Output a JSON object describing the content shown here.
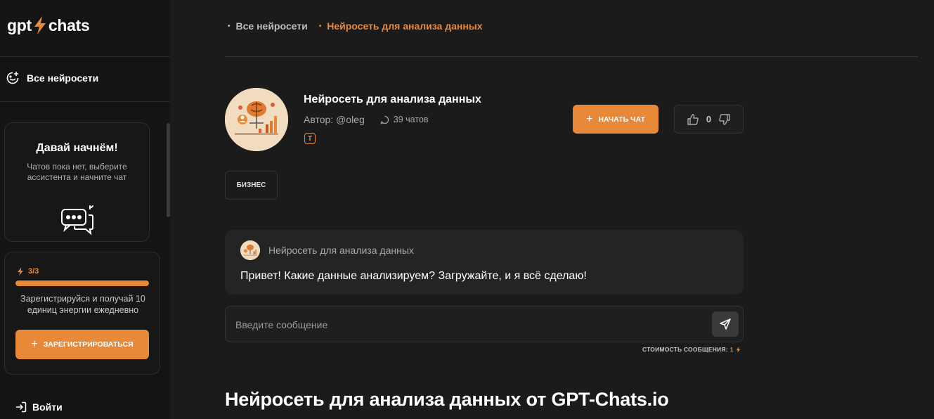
{
  "logo": {
    "left": "gpt",
    "right": "chats"
  },
  "sidebar": {
    "nav_all": "Все нейросети",
    "start_card": {
      "title": "Давай начнём!",
      "text": "Чатов пока нет, выберите ассистента и начните чат"
    },
    "energy": {
      "counter": "3/3",
      "progress": 1.0,
      "text": "Зарегистрируйся и получай 10 единиц энергии ежедневно",
      "register_label": "ЗАРЕГИСТРИРОВАТЬСЯ"
    },
    "login_label": "Войти"
  },
  "breadcrumb": {
    "home": "Все нейросети",
    "current": "Нейросеть для анализа данных"
  },
  "bot": {
    "title": "Нейросеть для анализа данных",
    "author": "Автор: @oleg",
    "chats": "39 чатов",
    "type_icon": "T",
    "start_chat_label": "НАЧАТЬ ЧАТ",
    "votes": "0",
    "tag": "БИЗНЕС"
  },
  "message": {
    "sender": "Нейросеть для анализа данных",
    "text": "Привет! Какие данные анализируем? Загружайте, и я всё сделаю!"
  },
  "composer": {
    "placeholder": "Введите сообщение",
    "cost_label": "СТОИМОСТЬ СООБЩЕНИЯ:",
    "cost_value": "1"
  },
  "seo_heading": "Нейросеть для анализа данных от GPT-Chats.io",
  "colors": {
    "accent": "#e8893a",
    "background": "#1b1b1b",
    "sidebar": "#141414"
  }
}
